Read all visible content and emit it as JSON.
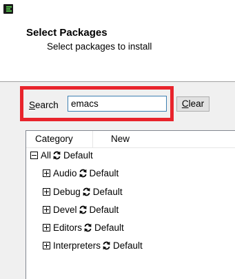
{
  "header": {
    "title": "Select Packages",
    "subtitle": "Select packages to install"
  },
  "search": {
    "label": "Search",
    "value": "emacs",
    "clear_label": "Clear"
  },
  "columns": [
    "Category",
    "New"
  ],
  "tree": {
    "root": {
      "label": "All",
      "status": "Default",
      "expanded": true
    },
    "children": [
      {
        "label": "Audio",
        "status": "Default"
      },
      {
        "label": "Debug",
        "status": "Default"
      },
      {
        "label": "Devel",
        "status": "Default"
      },
      {
        "label": "Editors",
        "status": "Default"
      },
      {
        "label": "Interpreters",
        "status": "Default"
      }
    ]
  },
  "colors": {
    "highlight": "#e8242c",
    "app_icon_bg": "#1a1a1a",
    "app_icon_accent": "#55c24a"
  },
  "icons": {
    "app": "cygwin-setup-icon",
    "status": "cycle-arrows-icon",
    "expander_root": "minus-box-icon",
    "expander_child": "plus-box-icon"
  }
}
